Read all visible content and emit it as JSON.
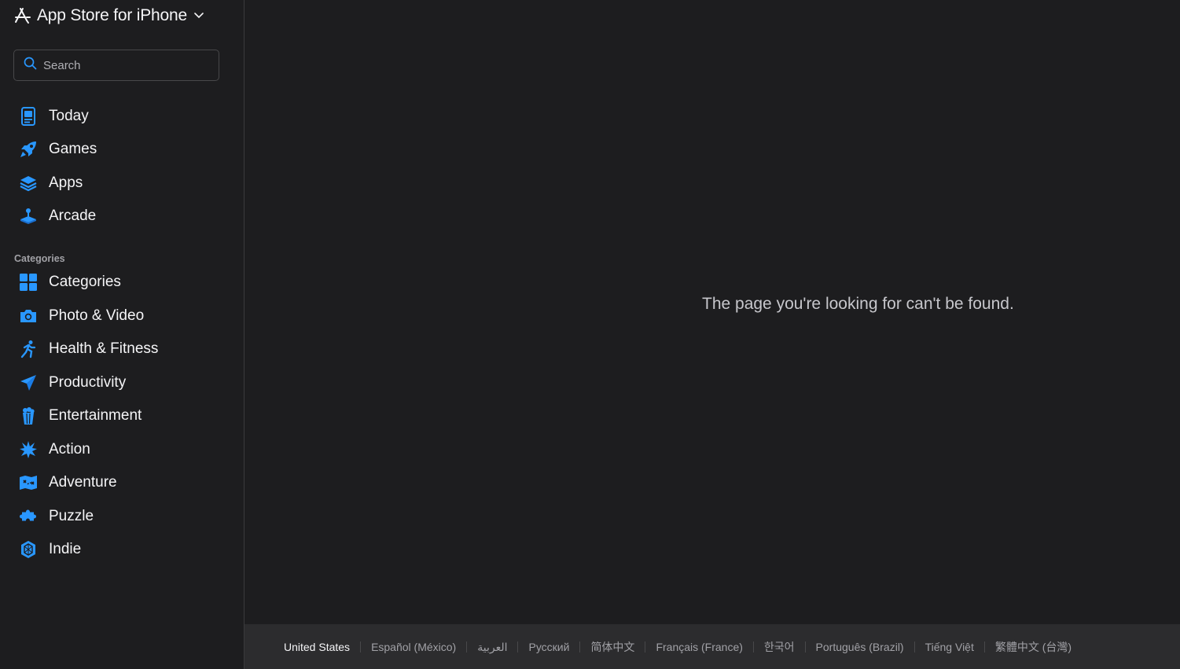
{
  "header": {
    "title": "App Store for iPhone"
  },
  "search": {
    "placeholder": "Search"
  },
  "nav": {
    "today": "Today",
    "games": "Games",
    "apps": "Apps",
    "arcade": "Arcade"
  },
  "categories": {
    "heading": "Categories",
    "items": [
      {
        "label": "Categories",
        "icon": "grid-icon"
      },
      {
        "label": "Photo & Video",
        "icon": "camera-icon"
      },
      {
        "label": "Health & Fitness",
        "icon": "running-figure-icon"
      },
      {
        "label": "Productivity",
        "icon": "paper-plane-icon"
      },
      {
        "label": "Entertainment",
        "icon": "popcorn-icon"
      },
      {
        "label": "Action",
        "icon": "burst-icon"
      },
      {
        "label": "Adventure",
        "icon": "treasure-map-icon"
      },
      {
        "label": "Puzzle",
        "icon": "puzzle-piece-icon"
      },
      {
        "label": "Indie",
        "icon": "hexagon-icon"
      }
    ]
  },
  "main": {
    "message": "The page you're looking for can't be found."
  },
  "footer": {
    "languages": [
      "United States",
      "Español (México)",
      "العربية",
      "Русский",
      "简体中文",
      "Français (France)",
      "한국어",
      "Português (Brazil)",
      "Tiếng Việt",
      "繁體中文 (台灣)"
    ]
  },
  "colors": {
    "accent": "#2997ff",
    "background": "#1d1d1f",
    "footer": "#2c2c2e"
  }
}
